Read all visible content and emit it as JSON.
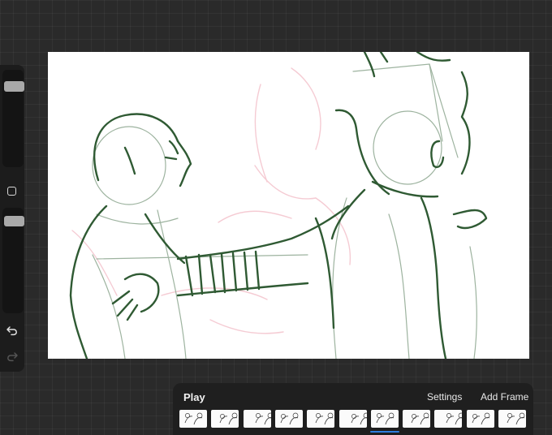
{
  "sidebar": {
    "brush_size_icon": "slider-thumb",
    "modify_icon": "square-outline-icon",
    "opacity_icon": "slider-thumb",
    "undo_icon": "undo-arrow-icon",
    "redo_icon": "redo-arrow-icon"
  },
  "canvas": {
    "line_color": "#2f5a33",
    "onion_skin_color": "#f4c6cf"
  },
  "timeline": {
    "play_label": "Play",
    "settings_label": "Settings",
    "add_frame_label": "Add Frame",
    "frame_count": 11,
    "selected_frame": 6,
    "accent_color": "#2e7fe0"
  }
}
